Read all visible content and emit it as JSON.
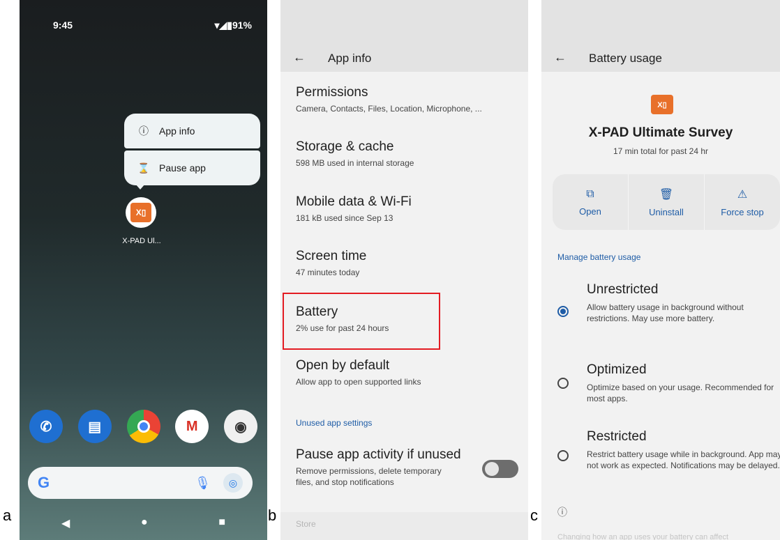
{
  "labels": {
    "a": "a",
    "b": "b",
    "c": "c"
  },
  "panel_a": {
    "time": "9:45",
    "status_icons": "▾◢▮91%",
    "popup": [
      {
        "icon": "info-icon",
        "label": "App info"
      },
      {
        "icon": "hourglass-icon",
        "label": "Pause app"
      }
    ],
    "app_label": "X-PAD Ul...",
    "dock": [
      "phone",
      "messages",
      "chrome",
      "gmail",
      "camera"
    ],
    "search_logo": "G"
  },
  "panel_b": {
    "title": "App info",
    "items": [
      {
        "title": "Permissions",
        "sub": "Camera, Contacts, Files, Location, Microphone, ..."
      },
      {
        "title": "Storage & cache",
        "sub": "598 MB used in internal storage"
      },
      {
        "title": "Mobile data & Wi-Fi",
        "sub": "181 kB used since Sep 13"
      },
      {
        "title": "Screen time",
        "sub": "47 minutes today"
      },
      {
        "title": "Battery",
        "sub": "2% use for past 24 hours"
      },
      {
        "title": "Open by default",
        "sub": "Allow app to open supported links"
      }
    ],
    "section": "Unused app settings",
    "pause": {
      "title": "Pause app activity if unused",
      "sub1": "Remove permissions, delete temporary",
      "sub2": "files, and stop notifications",
      "enabled": false
    },
    "store": "Store"
  },
  "panel_c": {
    "title": "Battery usage",
    "app_name": "X-PAD Ultimate Survey",
    "app_sub": "17 min total for past 24 hr",
    "actions": [
      {
        "icon": "open-icon",
        "label": "Open"
      },
      {
        "icon": "trash-icon",
        "label": "Uninstall"
      },
      {
        "icon": "warning-icon",
        "label": "Force stop"
      }
    ],
    "section": "Manage battery usage",
    "options": [
      {
        "title": "Unrestricted",
        "desc": "Allow battery usage in background without restrictions. May use more battery.",
        "selected": true
      },
      {
        "title": "Optimized",
        "desc": "Optimize based on your usage. Recommended for most apps.",
        "selected": false
      },
      {
        "title": "Restricted",
        "desc": "Restrict battery usage while in background. App may not work as expected. Notifications may be delayed.",
        "selected": false
      }
    ],
    "footer": "Changing how an app uses your battery can affect"
  }
}
